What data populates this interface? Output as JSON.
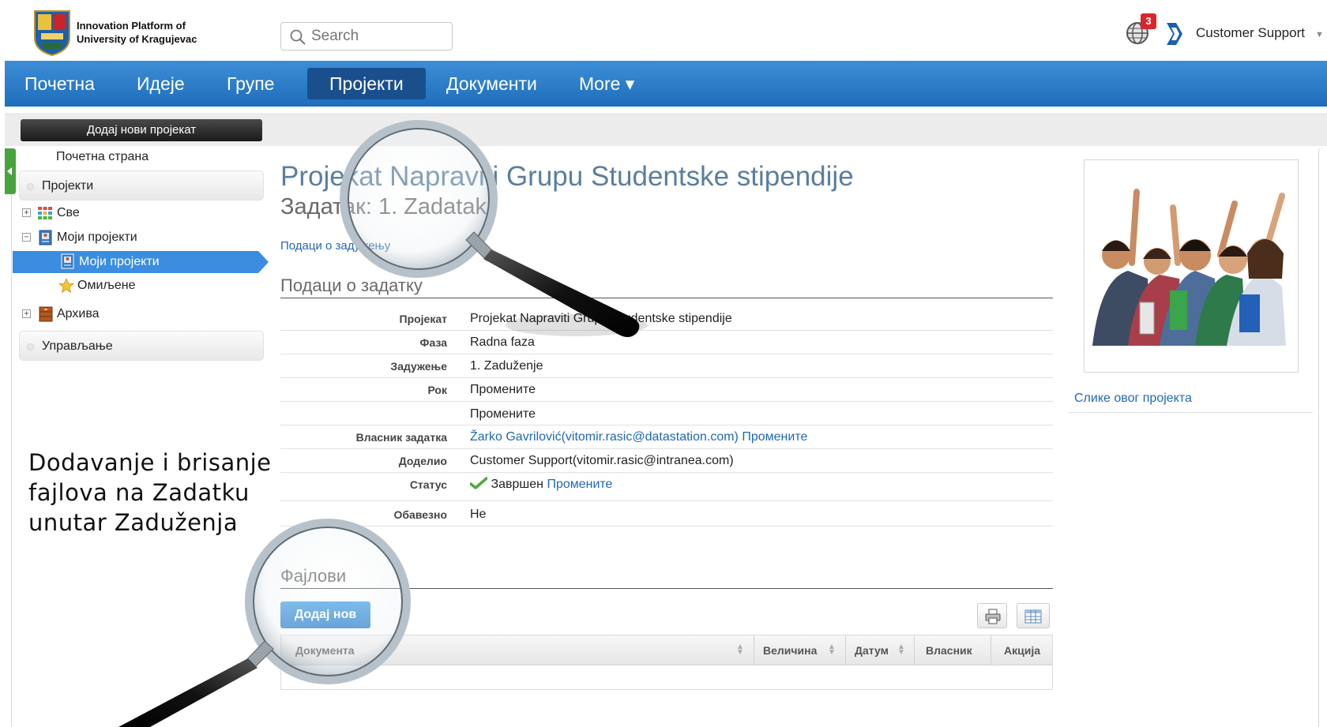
{
  "header": {
    "logo_line1": "Innovation Platform of",
    "logo_line2": "University of Kragujevac",
    "search_placeholder": "Search",
    "notification_count": "3",
    "user_name": "Customer Support"
  },
  "nav": {
    "items": [
      "Почетна",
      "Идеје",
      "Групе",
      "Пројекти",
      "Документи",
      "More ▾"
    ],
    "active_index": 3
  },
  "sidebar": {
    "add_button": "Додај нови пројекат",
    "home_link": "Почетна страна",
    "projects_section": "Пројекти",
    "tree": {
      "all": "Све",
      "my_projects": "Моји пројекти",
      "my_projects_selected": "Моји пројекти",
      "favorites": "Омиљене",
      "archive": "Архива"
    },
    "management_section": "Управљање"
  },
  "main": {
    "project_title": "Projekat Napraviti Grupu Studentske stipendije",
    "task_title": "Задатак: 1. Zadatak",
    "assignment_link": "Подаци о задужењу",
    "task_section_title": "Подаци о задатку",
    "fields": {
      "project_label": "Пројекат",
      "project_value": "Projekat Napraviti Grupu Studentske stipendije",
      "phase_label": "Фаза",
      "phase_value": "Radna faza",
      "assignment_label": "Задужење",
      "assignment_value": "1. Zaduženje",
      "deadline_label": "Рок",
      "change": "Промените",
      "owner_label": "Власник задатка",
      "owner_value": "Žarko Gavrilović(vitomir.rasic@datastation.com)",
      "assigned_by_label": "Доделио",
      "assigned_by_value": "Customer Support(vitomir.rasic@intranea.com)",
      "status_label": "Статус",
      "status_value": "Завршен",
      "mandatory_label": "Обавезно",
      "mandatory_value": "Не"
    },
    "files": {
      "title": "Фајлови",
      "add_button": "Додај нов",
      "columns": [
        "Документа",
        "Величина",
        "Датум",
        "Власник",
        "Акција"
      ]
    }
  },
  "right_panel": {
    "photos_link": "Слике овог пројекта"
  },
  "annotation": {
    "line1": "Dodavanje i brisanje",
    "line2": "fajlova na Zadatku",
    "line3": "unutar Zaduženja"
  },
  "colors": {
    "nav_blue": "#1f6dbb",
    "selected_blue": "#3b8de0",
    "link_blue": "#2168b5",
    "badge_red": "#d8262b"
  }
}
